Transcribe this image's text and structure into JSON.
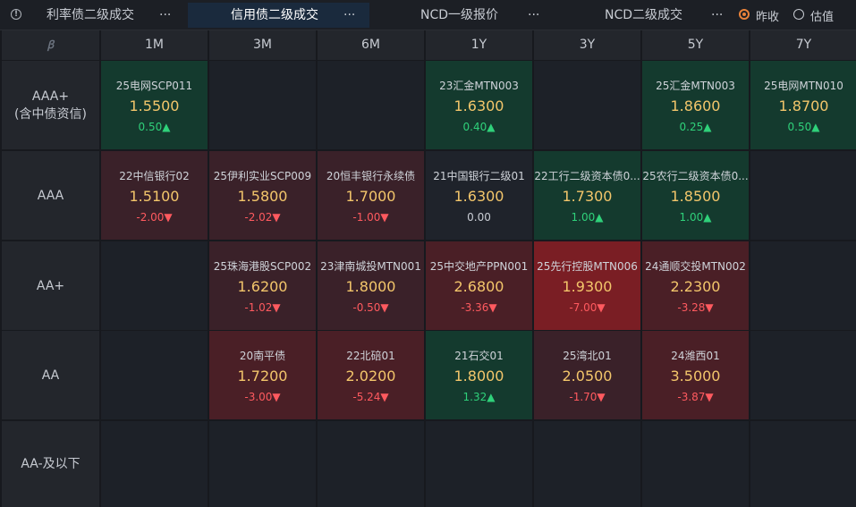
{
  "tabs": [
    {
      "label": "利率债二级成交",
      "more": "···"
    },
    {
      "label": "信用债二级成交",
      "more": "···"
    },
    {
      "label": "NCD一级报价",
      "more": "···"
    },
    {
      "label": "NCD二级成交",
      "more": "···"
    }
  ],
  "info_icon": "info-circle-icon",
  "price_mode": [
    {
      "label": "昨收",
      "checked": true
    },
    {
      "label": "估值",
      "checked": false
    }
  ],
  "corner_logo": "ꞵ",
  "columns": [
    "1M",
    "3M",
    "6M",
    "1Y",
    "3Y",
    "5Y",
    "7Y"
  ],
  "rows": [
    {
      "label": "AAA+",
      "sublabel": "(含中债资信)"
    },
    {
      "label": "AAA",
      "sublabel": ""
    },
    {
      "label": "AA+",
      "sublabel": ""
    },
    {
      "label": "AA",
      "sublabel": ""
    },
    {
      "label": "AA-及以下",
      "sublabel": ""
    }
  ],
  "cells": [
    [
      {
        "name": "25电网SCP011",
        "price": "1.5500",
        "change": "0.50▲",
        "dir": "up",
        "tone": "green"
      },
      null,
      null,
      {
        "name": "23汇金MTN003",
        "price": "1.6300",
        "change": "0.40▲",
        "dir": "up",
        "tone": "green"
      },
      null,
      {
        "name": "25汇金MTN003",
        "price": "1.8600",
        "change": "0.25▲",
        "dir": "up",
        "tone": "green"
      },
      {
        "name": "25电网MTN010",
        "price": "1.8700",
        "change": "0.50▲",
        "dir": "up",
        "tone": "green"
      }
    ],
    [
      {
        "name": "22中信银行02",
        "price": "1.5100",
        "change": "-2.00▼",
        "dir": "down",
        "tone": "red1"
      },
      {
        "name": "25伊利实业SCP009",
        "price": "1.5800",
        "change": "-2.02▼",
        "dir": "down",
        "tone": "red1"
      },
      {
        "name": "20恒丰银行永续债",
        "price": "1.7000",
        "change": "-1.00▼",
        "dir": "down",
        "tone": "red1"
      },
      {
        "name": "21中国银行二级01",
        "price": "1.6300",
        "change": "0.00",
        "dir": "flat",
        "tone": "neutral"
      },
      {
        "name": "22工行二级资本债0...",
        "price": "1.7300",
        "change": "1.00▲",
        "dir": "up",
        "tone": "green"
      },
      {
        "name": "25农行二级资本债0...",
        "price": "1.8500",
        "change": "1.00▲",
        "dir": "up",
        "tone": "green"
      },
      null
    ],
    [
      null,
      {
        "name": "25珠海港股SCP002",
        "price": "1.6200",
        "change": "-1.02▼",
        "dir": "down",
        "tone": "red1"
      },
      {
        "name": "23津南城投MTN001",
        "price": "1.8000",
        "change": "-0.50▼",
        "dir": "down",
        "tone": "red1"
      },
      {
        "name": "25中交地产PPN001",
        "price": "2.6800",
        "change": "-3.36▼",
        "dir": "down",
        "tone": "red2"
      },
      {
        "name": "25先行控股MTN006",
        "price": "1.9300",
        "change": "-7.00▼",
        "dir": "down",
        "tone": "red3"
      },
      {
        "name": "24通顺交投MTN002",
        "price": "2.2300",
        "change": "-3.28▼",
        "dir": "down",
        "tone": "red2"
      },
      null
    ],
    [
      null,
      {
        "name": "20南平债",
        "price": "1.7200",
        "change": "-3.00▼",
        "dir": "down",
        "tone": "red2"
      },
      {
        "name": "22北碚01",
        "price": "2.0200",
        "change": "-5.24▼",
        "dir": "down",
        "tone": "red2"
      },
      {
        "name": "21石交01",
        "price": "1.8000",
        "change": "1.32▲",
        "dir": "up",
        "tone": "green"
      },
      {
        "name": "25湾北01",
        "price": "2.0500",
        "change": "-1.70▼",
        "dir": "down",
        "tone": "red1"
      },
      {
        "name": "24潍西01",
        "price": "3.5000",
        "change": "-3.87▼",
        "dir": "down",
        "tone": "red2"
      },
      null
    ],
    [
      null,
      null,
      null,
      null,
      null,
      null,
      null
    ]
  ]
}
